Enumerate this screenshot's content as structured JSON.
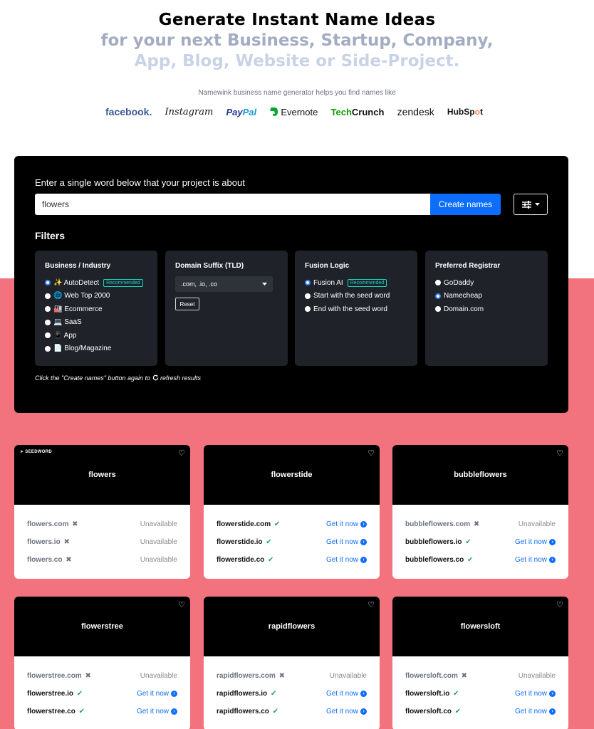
{
  "hero": {
    "line1": "Generate Instant Name Ideas",
    "line2": "for your next Business, Startup, Company,",
    "line3": "App, Blog, Website or Side-Project.",
    "tagline": "Namewink business name generator helps you find names like"
  },
  "logos": [
    {
      "name": "facebook",
      "label": "facebook."
    },
    {
      "name": "instagram",
      "label": "Instagram"
    },
    {
      "name": "paypal",
      "label_a": "Pay",
      "label_b": "Pal"
    },
    {
      "name": "evernote",
      "label": "Evernote"
    },
    {
      "name": "techcrunch",
      "label_a": "Tech",
      "label_b": "Crunch"
    },
    {
      "name": "zendesk",
      "label": "zendesk"
    },
    {
      "name": "hubspot",
      "label_a": "HubSp",
      "label_b": "o",
      "label_c": "t"
    }
  ],
  "search": {
    "prompt": "Enter a single word below that your project is about",
    "value": "flowers",
    "button": "Create names"
  },
  "filters": {
    "title": "Filters",
    "industry": {
      "title": "Business / Industry",
      "options": [
        {
          "label": "✨ AutoDetect",
          "badge": "Recommended",
          "selected": true
        },
        {
          "label": "🌐 Web Top 2000",
          "selected": false
        },
        {
          "label": "🏭 Ecommerce",
          "selected": false
        },
        {
          "label": "💻 SaaS",
          "selected": false
        },
        {
          "label": "📱 App",
          "selected": false
        },
        {
          "label": "📄 Blog/Magazine",
          "selected": false
        }
      ]
    },
    "tld": {
      "title": "Domain Suffix (TLD)",
      "value": ".com, .io, .co",
      "reset": "Reset"
    },
    "fusion": {
      "title": "Fusion Logic",
      "options": [
        {
          "label": "Fusion AI",
          "badge": "Recommended",
          "selected": true
        },
        {
          "label": "Start with the seed word",
          "selected": false
        },
        {
          "label": "End with the seed word",
          "selected": false
        }
      ]
    },
    "registrar": {
      "title": "Preferred Registrar",
      "options": [
        {
          "label": "GoDaddy",
          "selected": false
        },
        {
          "label": "Namecheap",
          "selected": true
        },
        {
          "label": "Domain.com",
          "selected": false
        }
      ]
    },
    "note_a": "Click the \"Create names\" button again to",
    "note_b": "refresh results"
  },
  "seed_label": "SEEDWORD",
  "labels": {
    "unavailable": "Unavailable",
    "get_it_now": "Get it now"
  },
  "cards": [
    {
      "name": "flowers",
      "seed": true,
      "domains": [
        {
          "domain": "flowers.com",
          "available": false
        },
        {
          "domain": "flowers.io",
          "available": false
        },
        {
          "domain": "flowers.co",
          "available": false
        }
      ]
    },
    {
      "name": "flowerstide",
      "seed": false,
      "domains": [
        {
          "domain": "flowerstide.com",
          "available": true
        },
        {
          "domain": "flowerstide.io",
          "available": true
        },
        {
          "domain": "flowerstide.co",
          "available": true
        }
      ]
    },
    {
      "name": "bubbleflowers",
      "seed": false,
      "domains": [
        {
          "domain": "bubbleflowers.com",
          "available": false
        },
        {
          "domain": "bubbleflowers.io",
          "available": true
        },
        {
          "domain": "bubbleflowers.co",
          "available": true
        }
      ]
    },
    {
      "name": "flowerstree",
      "seed": false,
      "domains": [
        {
          "domain": "flowerstree.com",
          "available": false
        },
        {
          "domain": "flowerstree.io",
          "available": true
        },
        {
          "domain": "flowerstree.co",
          "available": true
        }
      ]
    },
    {
      "name": "rapidflowers",
      "seed": false,
      "domains": [
        {
          "domain": "rapidflowers.com",
          "available": false
        },
        {
          "domain": "rapidflowers.io",
          "available": true
        },
        {
          "domain": "rapidflowers.co",
          "available": true
        }
      ]
    },
    {
      "name": "flowersloft",
      "seed": false,
      "domains": [
        {
          "domain": "flowersloft.com",
          "available": false
        },
        {
          "domain": "flowersloft.io",
          "available": true
        },
        {
          "domain": "flowersloft.co",
          "available": true
        }
      ]
    }
  ]
}
